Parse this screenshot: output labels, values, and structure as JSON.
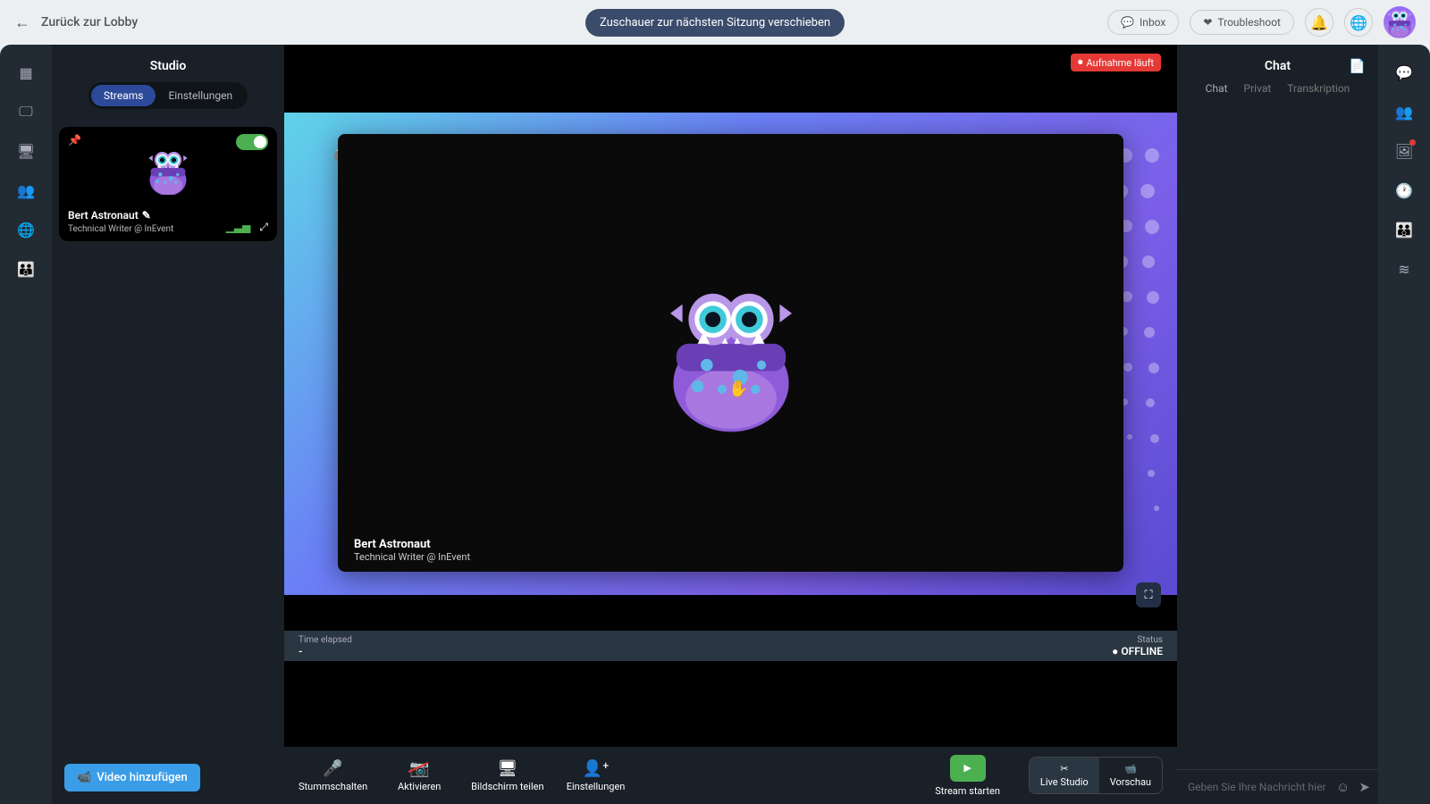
{
  "topbar": {
    "back_label": "Zurück zur Lobby",
    "move_viewers": "Zuschauer zur nächsten Sitzung verschieben",
    "inbox": "Inbox",
    "troubleshoot": "Troubleshoot"
  },
  "studio": {
    "title": "Studio",
    "tabs": {
      "streams": "Streams",
      "settings": "Einstellungen"
    },
    "card": {
      "name": "Bert Astronaut",
      "role": "Technical Writer @ InEvent"
    },
    "add_video": "Video hinzufügen"
  },
  "stage": {
    "recording": "Aufnahme läuft",
    "name": "Bert Astronaut",
    "role": "Technical Writer @ InEvent",
    "time_label": "Time elapsed",
    "time_value": "-",
    "status_label": "Status",
    "status_value": "OFFLINE"
  },
  "controls": {
    "mute": "Stummschalten",
    "activate": "Aktivieren",
    "share": "Bildschirm teilen",
    "settings": "Einstellungen",
    "start_stream": "Stream starten",
    "live_studio": "Live Studio",
    "preview": "Vorschau"
  },
  "chat": {
    "title": "Chat",
    "tabs": {
      "chat": "Chat",
      "private": "Privat",
      "transcription": "Transkription"
    },
    "placeholder": "Geben Sie Ihre Nachricht hier ein"
  }
}
